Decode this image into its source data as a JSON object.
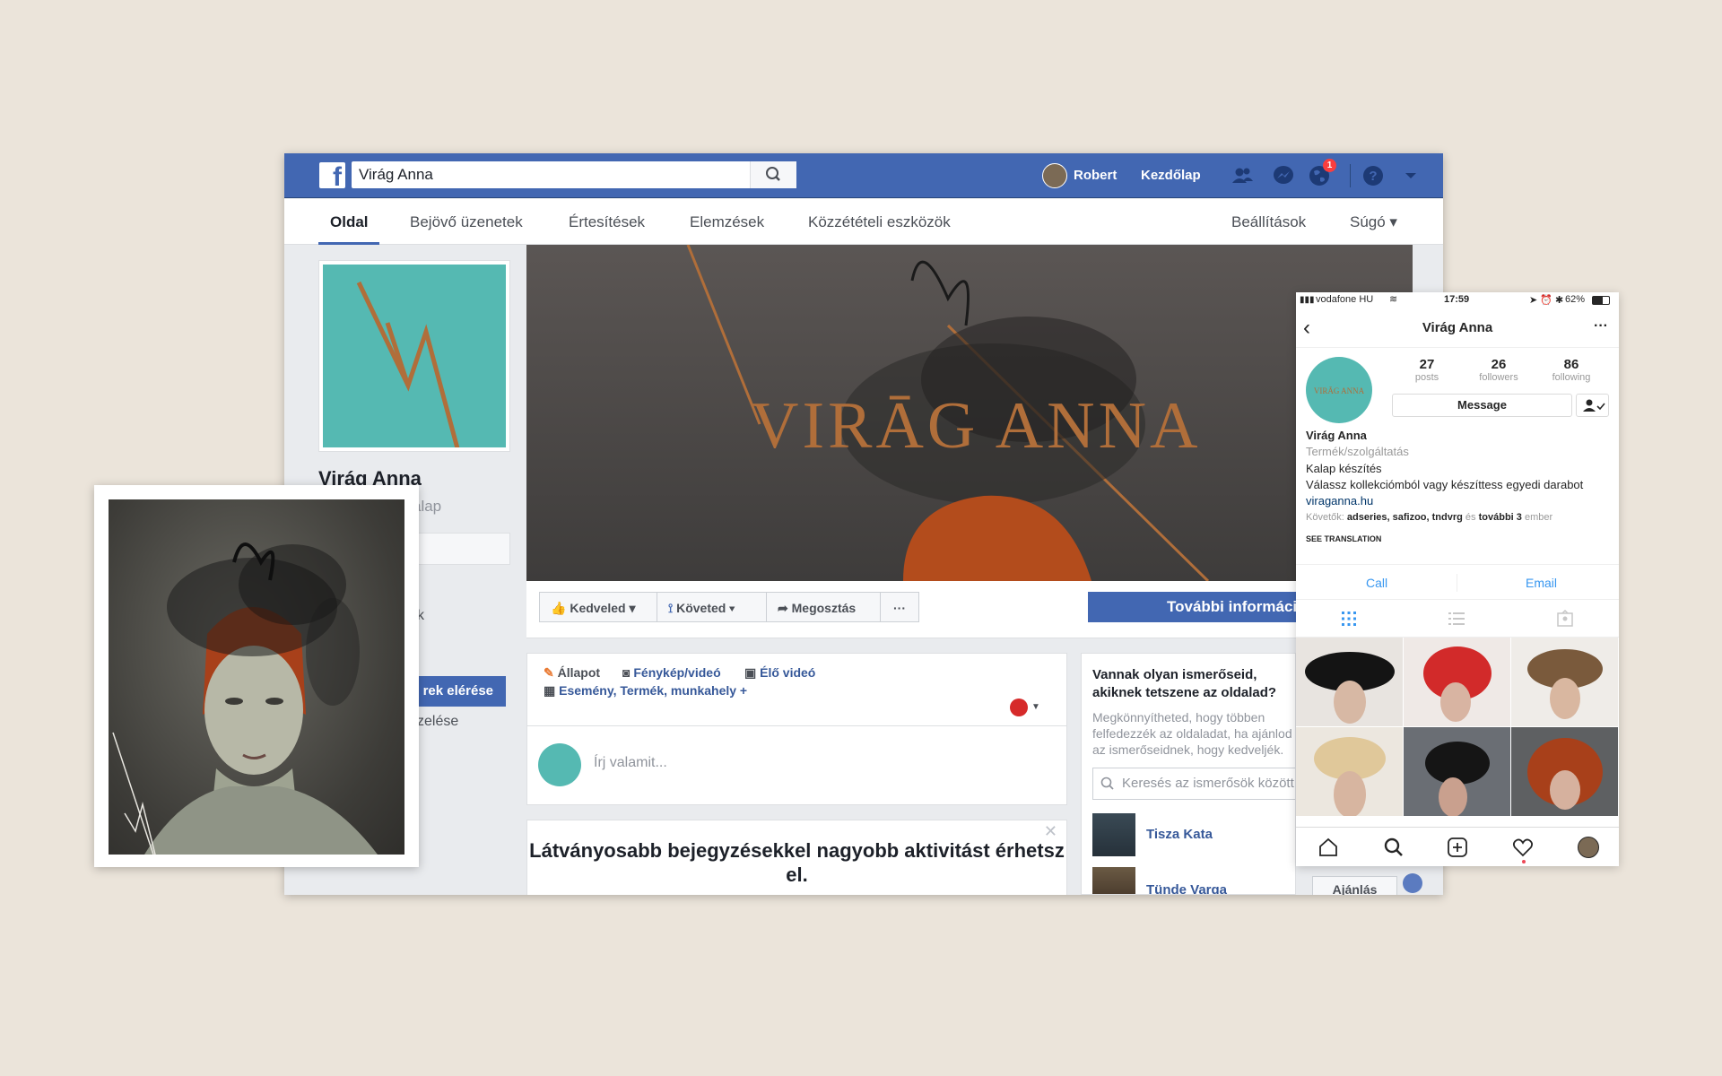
{
  "facebook": {
    "search_value": "Virág Anna",
    "user_name": "Robert",
    "home_label": "Kezdőlap",
    "notification_count": "1",
    "tabs": [
      "Oldal",
      "Bejövő üzenetek",
      "Értesítések",
      "Elemzések",
      "Közzétételi eszközök"
    ],
    "right_tabs": [
      "Beállítások",
      "Súgó ▾"
    ],
    "page_name": "Virág Anna",
    "page_category_partial": "alap",
    "left_link_partial_1": "k",
    "left_button_partial": "rek elérése",
    "left_link_partial_2": "zelése",
    "cover_title": "VIRĀG ANNA",
    "actions": [
      "Kedveled ▾",
      "Követed ▾",
      "Megosztás",
      "···"
    ],
    "more_info": "További információ",
    "composer": {
      "status": "Állapot",
      "photo": "Fénykép/videó",
      "live": "Élő videó",
      "more": "Esemény, Termék, munkahely +",
      "placeholder": "Írj valamit..."
    },
    "promo_text": "Látványosabb bejegyzésekkel nagyobb aktivitást érhetsz el.",
    "invite": {
      "title": "Vannak olyan ismerőseid, akiknek tetszene az oldalad?",
      "desc": "Megkönnyítheted, hogy többen felfedezzék az oldaladat, ha ajánlod az ismerőseidnek, hogy kedveljék.",
      "search_placeholder": "Keresés az ismerősök között",
      "friends": [
        "Tisza Kata",
        "Tünde Varga"
      ],
      "button": "Ajánlás"
    }
  },
  "instagram": {
    "carrier": "vodafone HU",
    "time": "17:59",
    "battery": "62%",
    "title": "Virág Anna",
    "stats": [
      {
        "value": "27",
        "label": "posts"
      },
      {
        "value": "26",
        "label": "followers"
      },
      {
        "value": "86",
        "label": "following"
      }
    ],
    "message_button": "Message",
    "name": "Virág Anna",
    "category": "Termék/szolgáltatás",
    "bio_1": "Kalap készítés",
    "bio_2": "Válassz kollekciómból vagy készíttess egyedi darabot",
    "link": "viraganna.hu",
    "followed_by_prefix": "Követők:",
    "followed_by_names": "adseries, safizoo, tndvrg",
    "followed_by_and": "és",
    "followed_by_more": "további 3",
    "followed_by_suffix": "ember",
    "see_translation": "SEE TRANSLATION",
    "call": "Call",
    "email": "Email"
  },
  "colors": {
    "fb_blue": "#4267b2",
    "teal": "#55b9b2",
    "copper": "#b06e3a",
    "ig_blue": "#3897f0"
  }
}
